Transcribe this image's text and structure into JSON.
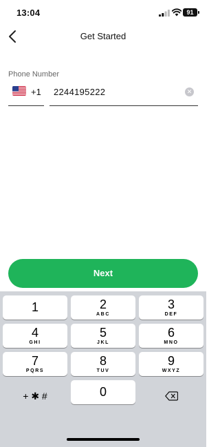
{
  "status_bar": {
    "time": "13:04",
    "battery": "91"
  },
  "nav": {
    "title": "Get Started",
    "back_icon": "chevron-left-icon"
  },
  "phone": {
    "label": "Phone Number",
    "country_code": "+1",
    "country_flag": "us-flag-icon",
    "value": "2244195222",
    "clear_icon": "clear-circle-icon"
  },
  "next_button": {
    "label": "Next",
    "color": "#1fb45a"
  },
  "keyboard": {
    "keys": [
      {
        "digit": "1",
        "letters": ""
      },
      {
        "digit": "2",
        "letters": "ABC"
      },
      {
        "digit": "3",
        "letters": "DEF"
      },
      {
        "digit": "4",
        "letters": "GHI"
      },
      {
        "digit": "5",
        "letters": "JKL"
      },
      {
        "digit": "6",
        "letters": "MNO"
      },
      {
        "digit": "7",
        "letters": "PQRS"
      },
      {
        "digit": "8",
        "letters": "TUV"
      },
      {
        "digit": "9",
        "letters": "WXYZ"
      },
      {
        "digit": "0",
        "letters": ""
      }
    ],
    "symbols_label": "+ ✱ #",
    "delete_icon": "backspace-icon"
  }
}
